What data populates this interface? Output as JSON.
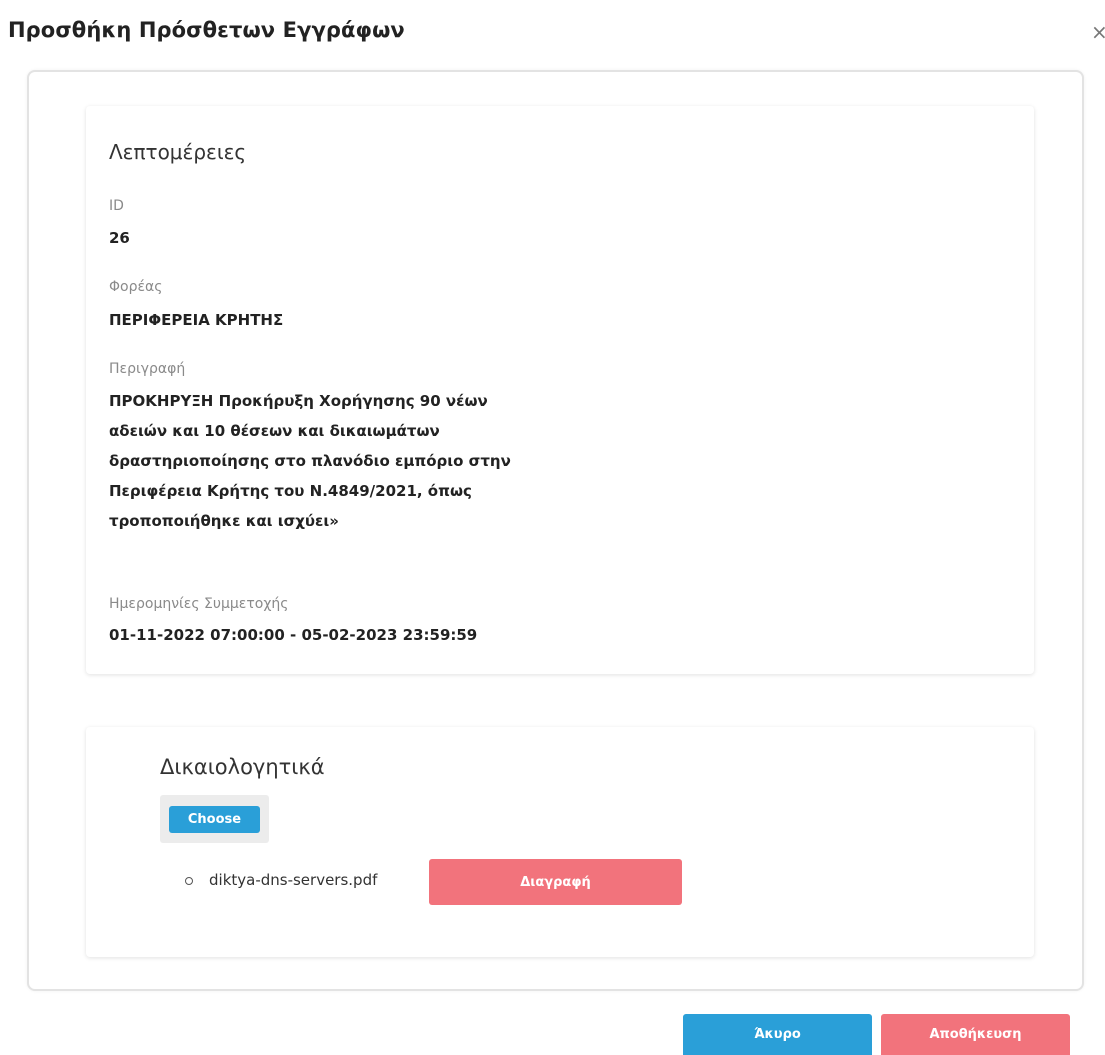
{
  "modal": {
    "title": "Προσθήκη Πρόσθετων Εγγράφων",
    "close_icon": "×"
  },
  "details": {
    "title": "Λεπτομέρειες",
    "fields": [
      {
        "label": "ID",
        "value": "26"
      },
      {
        "label": "Φορέας",
        "value": "ΠΕΡΙΦΕΡΕΙΑ ΚΡΗΤΗΣ"
      },
      {
        "label": "Περιγραφή",
        "value": "ΠΡΟΚΗΡΥΞΗ Προκήρυξη Χορήγησης 90 νέων αδειών και 10 θέσεων και δικαιωμάτων δραστηριοποίησης στο πλανόδιο εμπόριο στην Περιφέρεια Κρήτης του Ν.4849/2021, όπως τροποποιήθηκε και ισχύει»"
      },
      {
        "label": "Ημερομηνίες Συμμετοχής",
        "value": "01-11-2022 07:00:00 - 05-02-2023 23:59:59"
      }
    ]
  },
  "documents": {
    "title": "Δικαιολογητικά",
    "choose_label": "Choose",
    "files": [
      {
        "name": "diktya-dns-servers.pdf",
        "delete_label": "Διαγραφή"
      }
    ]
  },
  "footer": {
    "cancel_label": "Άκυρο",
    "save_label": "Αποθήκευση"
  },
  "colors": {
    "primary": "#2a9fd8",
    "danger": "#f2737c"
  }
}
